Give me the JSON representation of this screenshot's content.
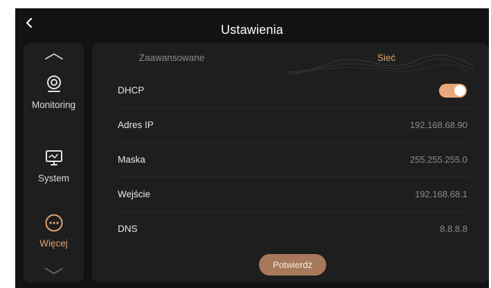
{
  "header": {
    "title": "Ustawienia",
    "back_icon": "chevron-left-icon"
  },
  "sidebar": {
    "scroll_up_icon": "chevron-up-icon",
    "scroll_down_icon": "chevron-down-icon",
    "items": [
      {
        "label": "Monitoring",
        "icon": "camera-icon",
        "active": false
      },
      {
        "label": "System",
        "icon": "monitor-icon",
        "active": false
      },
      {
        "label": "Więcej",
        "icon": "more-icon",
        "active": true
      }
    ]
  },
  "tabs": [
    {
      "label": "Zaawansowane",
      "active": false
    },
    {
      "label": "Sieć",
      "active": true
    }
  ],
  "settings": {
    "dhcp": {
      "label": "DHCP",
      "enabled": true
    },
    "ip": {
      "label": "Adres IP",
      "value": "192.168.68.90"
    },
    "mask": {
      "label": "Maska",
      "value": "255.255.255.0"
    },
    "gateway": {
      "label": "Wejście",
      "value": "192.168.68.1"
    },
    "dns": {
      "label": "DNS",
      "value": "8.8.8.8"
    }
  },
  "confirm_label": "Potwierdź",
  "colors": {
    "accent": "#e0a570",
    "toggle_on": "#e8a87a",
    "button": "#a8785a",
    "background": "#121212",
    "panel": "#1e1e1e"
  }
}
